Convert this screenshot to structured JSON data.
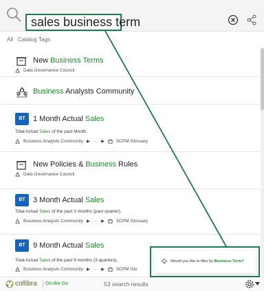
{
  "search": {
    "query": "sales business term"
  },
  "filter_tabs": [
    "All",
    "Catalog",
    "Tags"
  ],
  "results": [
    {
      "type": "policy-icon",
      "title_plain": "New ",
      "title_hl": "Business Terms",
      "title_rest": "",
      "desc_pre": "",
      "desc_hl": "",
      "desc_post": "",
      "path": [
        "Data Governance Council"
      ]
    },
    {
      "type": "community-icon",
      "title_plain": "",
      "title_hl": "Business",
      "title_rest": " Analysts Community",
      "desc_pre": "",
      "desc_hl": "",
      "desc_post": "",
      "path": []
    },
    {
      "type": "badge",
      "badge": "BT",
      "title_plain": "1 Month Actual ",
      "title_hl": "Sales",
      "title_rest": "",
      "desc_pre": "Total Actual ",
      "desc_hl": "Sales",
      "desc_post": " of the past Month.",
      "path": [
        "Business Analysts Community",
        "···",
        "SCPM Glossary"
      ]
    },
    {
      "type": "policy-icon",
      "title_plain": "New Policies & ",
      "title_hl": "Business",
      "title_rest": " Rules",
      "desc_pre": "",
      "desc_hl": "",
      "desc_post": "",
      "path": [
        "Data Governance Council"
      ]
    },
    {
      "type": "badge",
      "badge": "BT",
      "title_plain": "3 Month Actual ",
      "title_hl": "Sales",
      "title_rest": "",
      "desc_pre": "Total Actual ",
      "desc_hl": "Sales",
      "desc_post": " of the past 3 months (past quarter).",
      "path": [
        "Business Analysts Community",
        "···",
        "SCPM Glossary"
      ]
    },
    {
      "type": "badge",
      "badge": "BT",
      "title_plain": "9 Month Actual ",
      "title_hl": "Sales",
      "title_rest": "",
      "desc_pre": "Total Actual ",
      "desc_hl": "Sales",
      "desc_post": " of the past 9 months (3 quarters).",
      "path": [
        "Business Analysts Community",
        "···",
        "SCPM Glo"
      ]
    }
  ],
  "footer": {
    "logo": "collibra",
    "logo_sub": "On-the-Go",
    "count": "53 search results"
  },
  "tooltip": {
    "text_pre": "Would you like to filter by ",
    "text_hl": "Business Term?"
  },
  "colors": {
    "highlight": "#1f8a2e",
    "badge": "#1564b7",
    "annotation": "#1a7a52"
  }
}
